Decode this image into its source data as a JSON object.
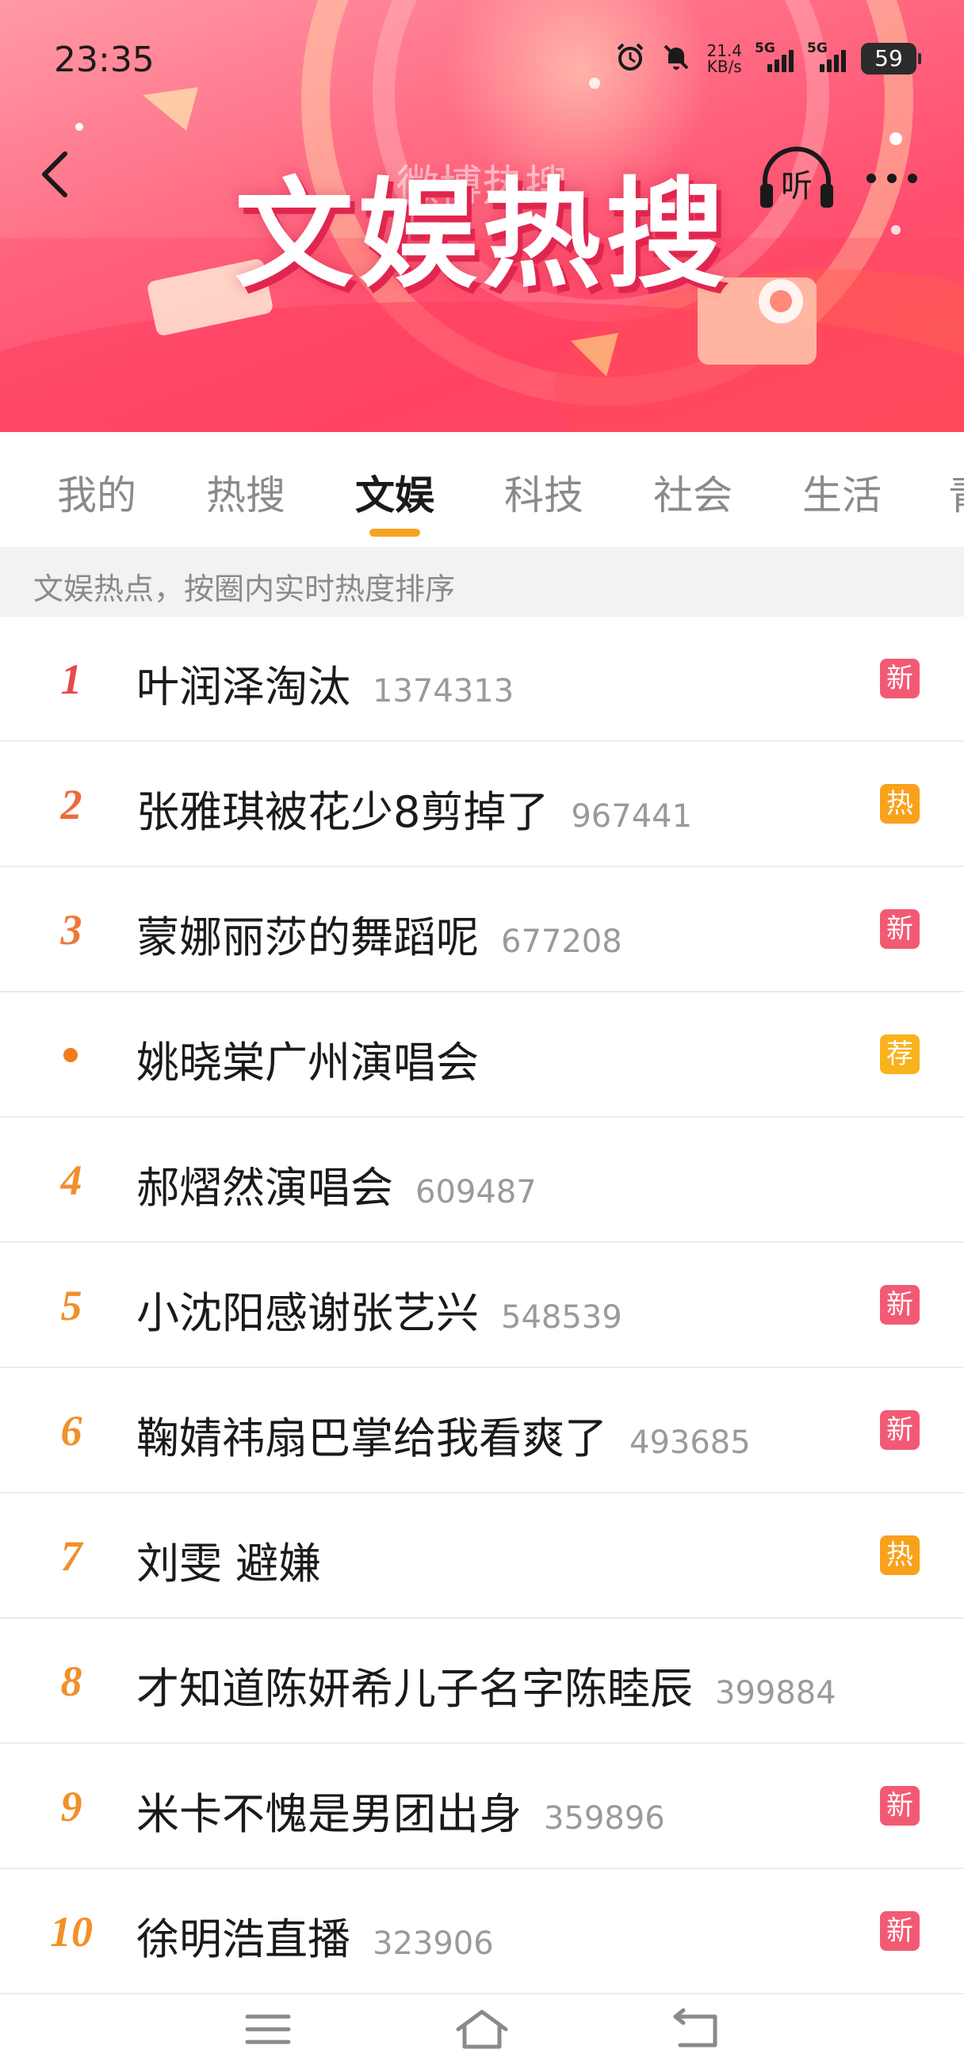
{
  "status_bar": {
    "time": "23:35",
    "net_speed_value": "21.4",
    "net_speed_unit": "KB/s",
    "signal_1_label": "5G",
    "signal_2_label": "5G",
    "battery": "59"
  },
  "banner": {
    "title": "文娱热搜",
    "page_title": "微博热搜"
  },
  "toolbar": {
    "listen_label": "听"
  },
  "tabs": [
    {
      "label": "我的",
      "active": false
    },
    {
      "label": "热搜",
      "active": false
    },
    {
      "label": "文娱",
      "active": true
    },
    {
      "label": "科技",
      "active": false
    },
    {
      "label": "社会",
      "active": false
    },
    {
      "label": "生活",
      "active": false
    },
    {
      "label": "青",
      "active": false
    }
  ],
  "subheader": "文娱热点，按圈内实时热度排序",
  "list": [
    {
      "rank": "1",
      "title": "叶润泽淘汰",
      "heat": "1374313",
      "badge": "新",
      "rank_color": "#e84a4a"
    },
    {
      "rank": "2",
      "title": "张雅琪被花少8剪掉了",
      "heat": "967441",
      "badge": "热",
      "rank_color": "#ef6a3c"
    },
    {
      "rank": "3",
      "title": "蒙娜丽莎的舞蹈呢",
      "heat": "677208",
      "badge": "新",
      "rank_color": "#ee7a3a"
    },
    {
      "rank": "",
      "title": "姚晓棠广州演唱会",
      "heat": "",
      "badge": "荐",
      "rank_color": "#f07c1e"
    },
    {
      "rank": "4",
      "title": "郝熠然演唱会",
      "heat": "609487",
      "badge": "",
      "rank_color": "#f0902a"
    },
    {
      "rank": "5",
      "title": "小沈阳感谢张艺兴",
      "heat": "548539",
      "badge": "新",
      "rank_color": "#f0902a"
    },
    {
      "rank": "6",
      "title": "鞠婧祎扇巴掌给我看爽了",
      "heat": "493685",
      "badge": "新",
      "rank_color": "#f0902a"
    },
    {
      "rank": "7",
      "title": "刘雯 避嫌",
      "heat": "",
      "badge": "热",
      "rank_color": "#f0902a"
    },
    {
      "rank": "8",
      "title": "才知道陈妍希儿子名字陈睦辰",
      "heat": "399884",
      "badge": "",
      "rank_color": "#f0902a"
    },
    {
      "rank": "9",
      "title": "米卡不愧是男团出身",
      "heat": "359896",
      "badge": "新",
      "rank_color": "#f0902a"
    },
    {
      "rank": "10",
      "title": "徐明浩直播",
      "heat": "323906",
      "badge": "新",
      "rank_color": "#f0902a"
    }
  ],
  "badge_colors": {
    "新": "#f25a74",
    "热": "#f9a11b",
    "荐": "#f9b21b"
  },
  "icons": {
    "back": "back-chevron-icon",
    "listen": "headphones-icon",
    "more": "more-dots-icon",
    "alarm": "alarm-clock-icon",
    "mute": "bell-off-icon",
    "menu": "menu-icon",
    "home": "home-icon",
    "return": "return-icon"
  }
}
